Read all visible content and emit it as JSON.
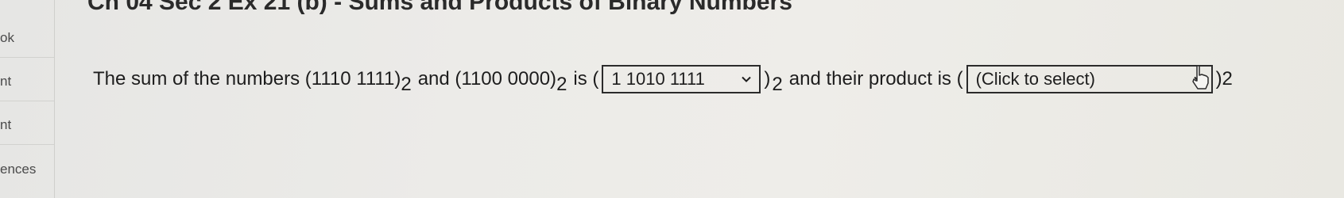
{
  "sidebar": {
    "items": [
      {
        "label": "ok"
      },
      {
        "label": "nt"
      },
      {
        "label": "nt"
      },
      {
        "label": "ences"
      }
    ]
  },
  "header": {
    "title": "Ch 04 Sec 2 Ex 21 (b) - Sums and Products of Binary Numbers"
  },
  "question": {
    "part1": "The sum of the numbers (1110 1111)",
    "sub1": "2",
    "part2": "and (1100 0000)",
    "sub2": "2",
    "part3": "is (",
    "sum_dropdown": {
      "value": "1 1010 1111",
      "icon": "chevron-down-icon"
    },
    "part4": ")",
    "sub3": "2",
    "part5": "and their product is (",
    "product_dropdown": {
      "value": "(Click to select)",
      "icon": "chevron-down-icon"
    },
    "part6": ")2"
  },
  "colors": {
    "text": "#1d1d1d",
    "dropdown_border": "#2b2b2b"
  }
}
